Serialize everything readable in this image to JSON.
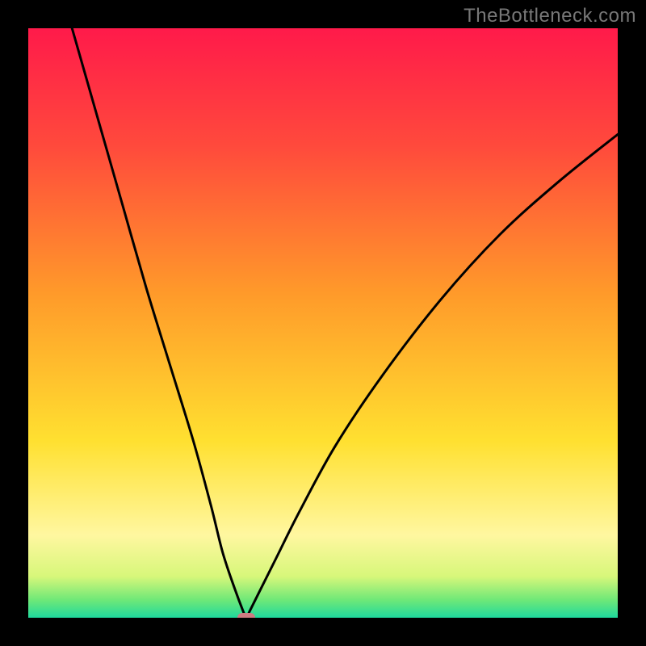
{
  "watermark": "TheBottleneck.com",
  "gradient_stops": [
    {
      "offset": "0%",
      "color": "#ff1a4a"
    },
    {
      "offset": "20%",
      "color": "#ff4a3c"
    },
    {
      "offset": "45%",
      "color": "#ff9a2a"
    },
    {
      "offset": "70%",
      "color": "#ffe030"
    },
    {
      "offset": "86%",
      "color": "#fff7a0"
    },
    {
      "offset": "93%",
      "color": "#d7f77a"
    },
    {
      "offset": "97%",
      "color": "#6ee878"
    },
    {
      "offset": "100%",
      "color": "#1fd99d"
    }
  ],
  "marker_color": "#cf7b82",
  "chart_data": {
    "type": "line",
    "title": "",
    "xlabel": "",
    "ylabel": "",
    "xlim": [
      0,
      100
    ],
    "ylim": [
      0,
      100
    ],
    "min_point": {
      "x": 37,
      "y": 0
    },
    "series": [
      {
        "name": "bottleneck-curve",
        "x": [
          0,
          4,
          8,
          12,
          16,
          20,
          24,
          28,
          31,
          33,
          35,
          36.5,
          37,
          37.5,
          39,
          42,
          46,
          52,
          60,
          70,
          80,
          90,
          100
        ],
        "y": [
          126,
          112,
          98,
          84,
          70,
          56,
          43,
          30,
          19,
          11,
          5,
          1,
          0,
          1,
          4,
          10,
          18,
          29,
          41,
          54,
          65,
          74,
          82
        ]
      }
    ],
    "annotations": [
      {
        "text": "TheBottleneck.com",
        "role": "watermark"
      }
    ]
  }
}
